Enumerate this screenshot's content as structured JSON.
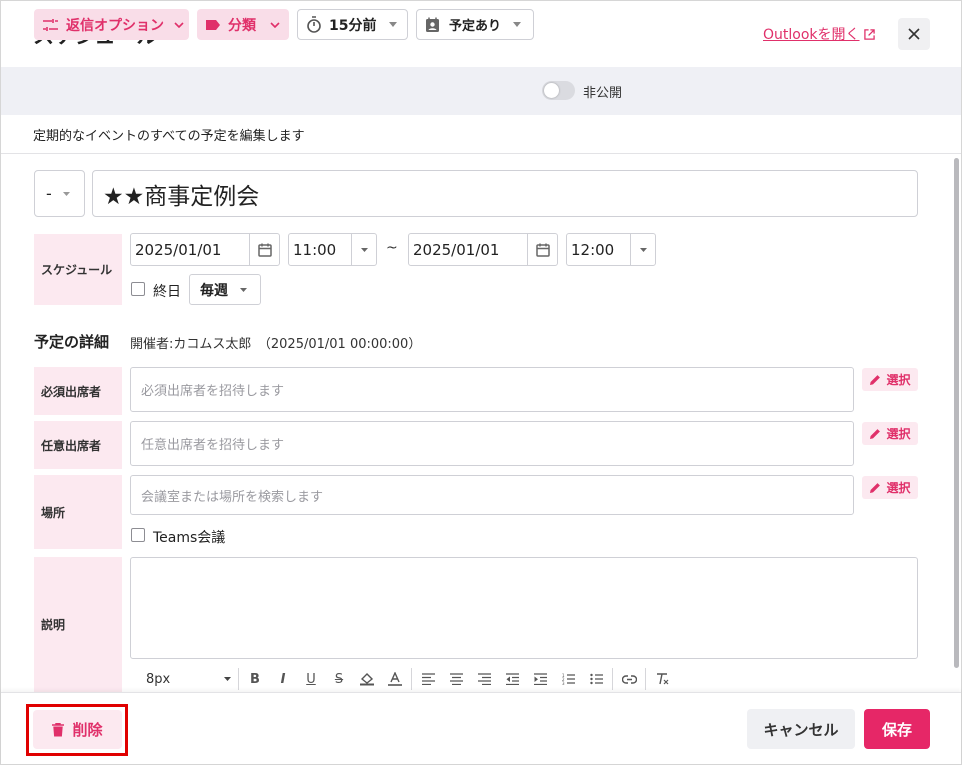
{
  "header": {
    "title": "スケジュール",
    "outlook_link": "Outlookを開く",
    "close_icon": "close-icon"
  },
  "toolbar": {
    "reply_options": "返信オプション",
    "category": "分類",
    "reminder": "15分前",
    "show_as": "予定あり",
    "private_label": "非公開",
    "private_on": false
  },
  "recurring_note": "定期的なイベントのすべての予定を編集します",
  "subject": {
    "priority": "-",
    "title": "★★商事定例会"
  },
  "schedule": {
    "label": "スケジュール",
    "start_date": "2025/01/01",
    "start_time": "11:00",
    "separator": "~",
    "end_date": "2025/01/01",
    "end_time": "12:00",
    "all_day_label": "終日",
    "recurrence": "毎週"
  },
  "details": {
    "section_title": "予定の詳細",
    "organizer": "開催者:カコムス太郎　（2025/01/01 00:00:00）",
    "required_label": "必須出席者",
    "required_placeholder": "必須出席者を招待します",
    "optional_label": "任意出席者",
    "optional_placeholder": "任意出席者を招待します",
    "location_label": "場所",
    "location_placeholder": "会議室または場所を検索します",
    "select_label": "選択",
    "teams_label": "Teams会議",
    "description_label": "説明"
  },
  "editor": {
    "font_size": "8px"
  },
  "footer": {
    "delete": "削除",
    "cancel": "キャンセル",
    "save": "保存"
  },
  "colors": {
    "accent": "#e62767",
    "accent_light": "#fce9f0",
    "highlight": "#e00000"
  }
}
